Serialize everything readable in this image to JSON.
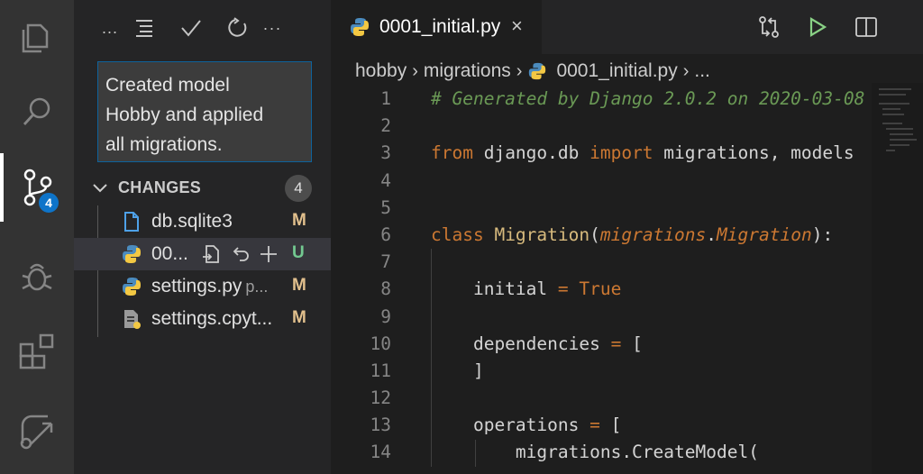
{
  "activity_bar": {
    "items": [
      {
        "name": "explorer",
        "icon": "files-icon"
      },
      {
        "name": "search",
        "icon": "search-icon"
      },
      {
        "name": "source-control",
        "icon": "source-control-icon",
        "badge": "4"
      },
      {
        "name": "run-debug",
        "icon": "debug-icon"
      },
      {
        "name": "extensions",
        "icon": "extensions-icon"
      },
      {
        "name": "remote",
        "icon": "remote-explorer-icon"
      }
    ]
  },
  "sidebar": {
    "toolbar": {
      "more_left": "...",
      "more_right": "···"
    },
    "commit_message_lines": [
      "Created model",
      "Hobby and applied",
      "all migrations."
    ],
    "changes": {
      "title": "CHANGES",
      "count": "4",
      "files": [
        {
          "name": "db.sqlite3",
          "description": "",
          "status": "M",
          "icon": "file-icon"
        },
        {
          "name": "00...",
          "description": "",
          "status": "U",
          "icon": "python-icon",
          "selected": true
        },
        {
          "name": "settings.py",
          "description": "p...",
          "status": "M",
          "icon": "python-icon"
        },
        {
          "name": "settings.cpyt...",
          "description": "",
          "status": "M",
          "icon": "compiled-python-icon"
        }
      ]
    }
  },
  "editor": {
    "tab": {
      "title": "0001_initial.py",
      "close": "×"
    },
    "breadcrumb": [
      "hobby",
      "migrations",
      "0001_initial.py",
      "..."
    ],
    "code_lines": [
      {
        "n": "1",
        "text": "# Generated by Django 2.0.2 on 2020-03-08"
      },
      {
        "n": "2",
        "text": ""
      },
      {
        "n": "3",
        "text": "from django.db import migrations, models"
      },
      {
        "n": "4",
        "text": ""
      },
      {
        "n": "5",
        "text": ""
      },
      {
        "n": "6",
        "text": "class Migration(migrations.Migration):"
      },
      {
        "n": "7",
        "text": ""
      },
      {
        "n": "8",
        "text": "    initial = True"
      },
      {
        "n": "9",
        "text": ""
      },
      {
        "n": "10",
        "text": "    dependencies = ["
      },
      {
        "n": "11",
        "text": "    ]"
      },
      {
        "n": "12",
        "text": ""
      },
      {
        "n": "13",
        "text": "    operations = ["
      },
      {
        "n": "14",
        "text": "        migrations.CreateModel("
      }
    ]
  },
  "colors": {
    "accent": "#0e74c9",
    "modified": "#e2c08d",
    "untracked": "#73c991",
    "keyword": "#cc7832",
    "comment": "#6a9955"
  }
}
